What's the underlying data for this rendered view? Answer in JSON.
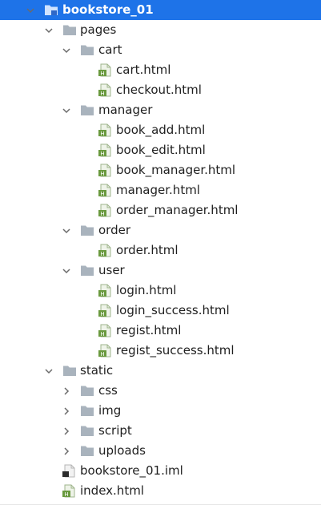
{
  "project_tree": {
    "root": "bookstore_01",
    "pages": "pages",
    "cart": {
      "folder": "cart",
      "files": [
        "cart.html",
        "checkout.html"
      ]
    },
    "manager": {
      "folder": "manager",
      "files": [
        "book_add.html",
        "book_edit.html",
        "book_manager.html",
        "manager.html",
        "order_manager.html"
      ]
    },
    "order": {
      "folder": "order",
      "files": [
        "order.html"
      ]
    },
    "user": {
      "folder": "user",
      "files": [
        "login.html",
        "login_success.html",
        "regist.html",
        "regist_success.html"
      ]
    },
    "static": {
      "folder": "static",
      "children": [
        "css",
        "img",
        "script",
        "uploads"
      ]
    },
    "root_files": [
      "bookstore_01.iml",
      "index.html"
    ]
  },
  "icons": {
    "folder": "folder-icon",
    "module_folder": "module-folder-icon",
    "html_file": "html-file-icon",
    "iml_file": "iml-file-icon",
    "chevron_down": "chevron-down-icon",
    "chevron_right": "chevron-right-icon"
  },
  "colors": {
    "selection": "#1e73e8",
    "folder": "#a9b3bd",
    "html_badge": "#6a9a3f",
    "text": "#1f1f1f"
  }
}
